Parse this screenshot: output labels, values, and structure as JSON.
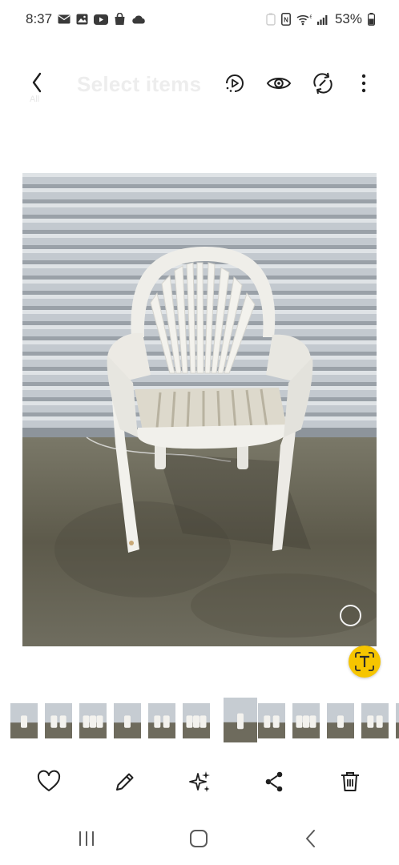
{
  "status_bar": {
    "time": "8:37",
    "battery_percent": "53%",
    "left_icons": [
      "mail-icon",
      "image-icon",
      "youtube-icon",
      "shopping-bag-icon",
      "cloud-icon"
    ],
    "right_icons": [
      "data-saver-icon",
      "nfc-icon",
      "wifi-icon",
      "signal-icon",
      "battery-icon"
    ]
  },
  "app_bar": {
    "ghost_title": "Select items",
    "ghost_all_label": "All",
    "actions": [
      "motion-photo-icon",
      "view-icon",
      "remaster-icon",
      "more-options-icon"
    ]
  },
  "photo": {
    "subject": "white plastic patio chair",
    "has_select_circle": true,
    "has_text_extract_button": true
  },
  "filmstrip": {
    "count": 12,
    "current_index": 6
  },
  "bottom_actions": [
    "favorite-icon",
    "edit-icon",
    "ai-edit-icon",
    "share-icon",
    "delete-icon"
  ],
  "nav_bar": [
    "recent-apps-icon",
    "home-icon",
    "back-nav-icon"
  ],
  "colors": {
    "accent_yellow": "#f6c500",
    "icon_dark": "#1f1f1f",
    "ghost_text": "#ededed"
  }
}
